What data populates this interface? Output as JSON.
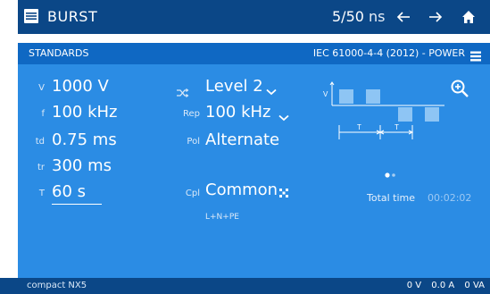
{
  "header": {
    "title": "BURST",
    "page": "5/50",
    "page_unit": "ns"
  },
  "standards": {
    "label": "STANDARDS",
    "standard": "IEC 61000-4-4 (2012) - POWER"
  },
  "params": {
    "voltage": {
      "label": "V",
      "value": "1000 V"
    },
    "frequency": {
      "label": "f",
      "value": "100 kHz"
    },
    "td": {
      "label": "td",
      "value": "0.75 ms"
    },
    "tr": {
      "label": "tr",
      "value": "300 ms"
    },
    "duration": {
      "label": "T",
      "value": "60 s"
    },
    "level": {
      "value": "Level 2"
    },
    "rep": {
      "label": "Rep",
      "value": "100 kHz"
    },
    "pol": {
      "label": "Pol",
      "value": "Alternate"
    },
    "cpl": {
      "label": "Cpl",
      "value": "Common",
      "sub": "L+N+PE"
    }
  },
  "waveform": {
    "v_label": "V",
    "t1_label": "T",
    "t2_label": "T"
  },
  "total_time": {
    "label": "Total time",
    "value": "00:02:02"
  },
  "footer": {
    "device": "compact NX5",
    "voltage_reading": "0 V",
    "current_reading": "0.0 A",
    "power_reading": "0 VA"
  },
  "colors": {
    "title_bar": "#0b4787",
    "standards_bar": "#0f68c3",
    "panel": "#2b8ce4",
    "waveform_fill": "#8ec5f4"
  },
  "icons": {
    "menu": "menu-icon",
    "back": "arrow-left-icon",
    "forward": "arrow-right-icon",
    "home": "home-icon",
    "list": "list-icon",
    "zoom": "zoom-in-icon",
    "shuffle": "shuffle-icon",
    "dropdown": "chevron-down-icon",
    "coupling": "coupling-dots-icon"
  }
}
